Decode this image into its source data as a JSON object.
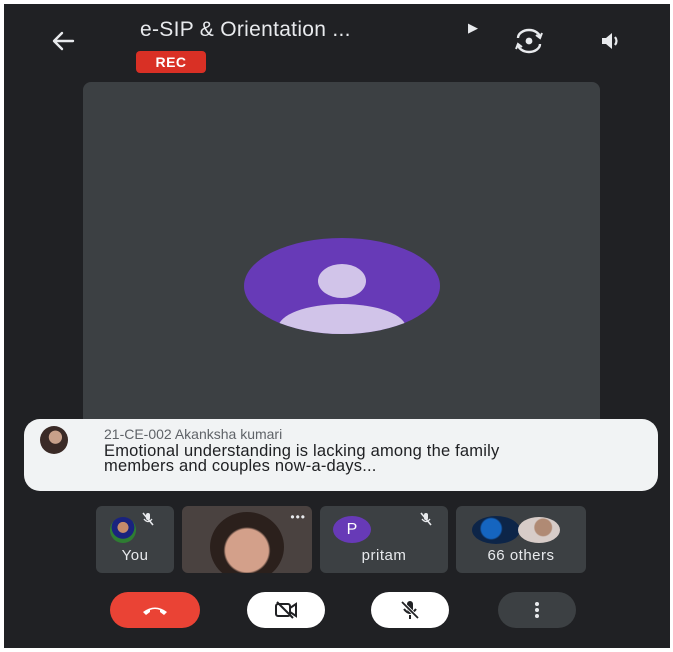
{
  "header": {
    "title": "e-SIP & Orientation ...",
    "title_expand_icon": "caret-right-icon",
    "recording_badge": "REC",
    "back_icon": "arrow-left-icon",
    "switch_camera_icon": "switch-camera-icon",
    "audio_icon": "volume-icon"
  },
  "main_tile": {
    "avatar_icon": "person-avatar-icon",
    "avatar_color": "#673ab7"
  },
  "caption": {
    "speaker": "21-CE-002 Akanksha kumari",
    "text": "Emotional understanding is lacking among the family members and couples now-a-days..."
  },
  "participants": [
    {
      "label": "You",
      "muted": true
    },
    {
      "label": "",
      "video": true
    },
    {
      "label": "pritam",
      "initial": "P",
      "muted": true
    },
    {
      "label": "66 others"
    }
  ],
  "controls": {
    "end_call_icon": "end-call-icon",
    "camera_icon": "camera-off-icon",
    "mic_icon": "mic-off-icon",
    "more_icon": "more-vert-icon",
    "end_call_color": "#ea4335"
  }
}
